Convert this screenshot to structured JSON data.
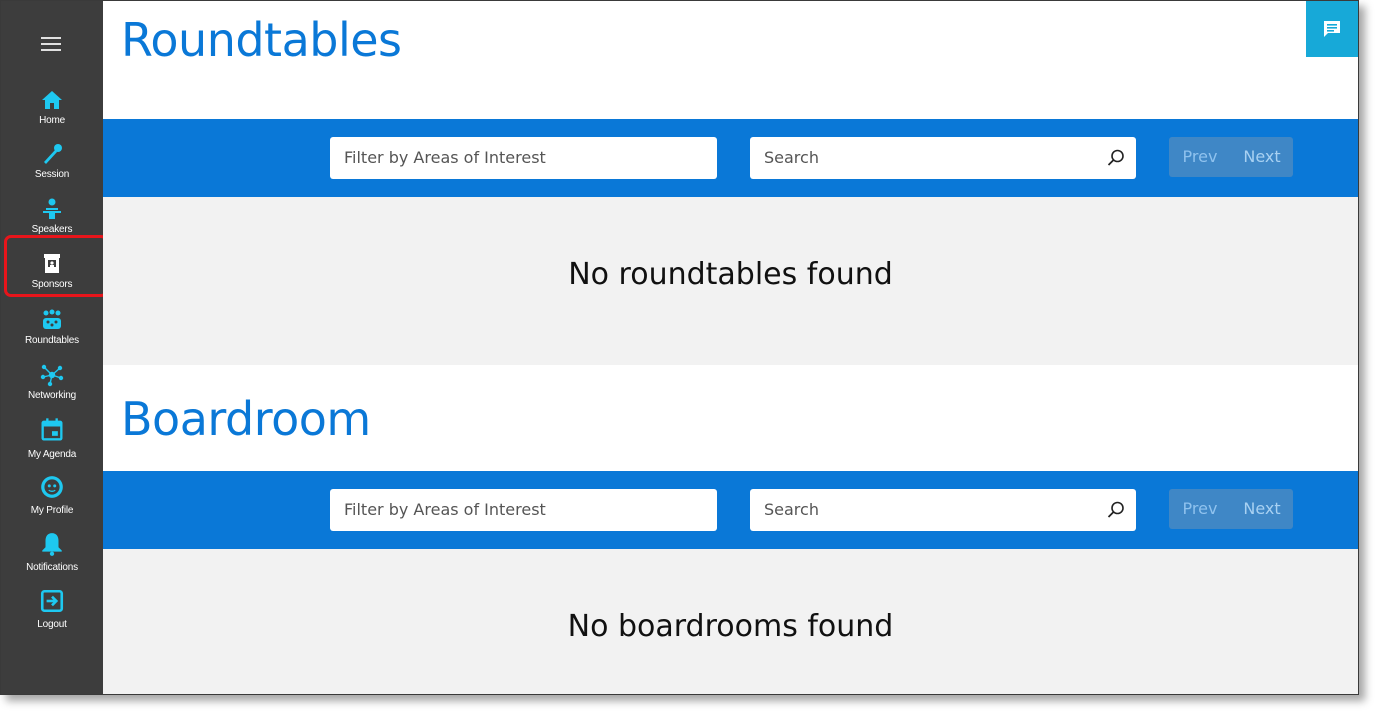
{
  "sidebar": {
    "items": [
      {
        "label": "Home",
        "icon": "home-icon"
      },
      {
        "label": "Session",
        "icon": "microphone-icon"
      },
      {
        "label": "Speakers",
        "icon": "speaker-icon"
      },
      {
        "label": "Sponsors",
        "icon": "booth-icon"
      },
      {
        "label": "Roundtables",
        "icon": "group-icon"
      },
      {
        "label": "Networking",
        "icon": "network-icon"
      },
      {
        "label": "My Agenda",
        "icon": "calendar-icon"
      },
      {
        "label": "My Profile",
        "icon": "profile-icon"
      },
      {
        "label": "Notifications",
        "icon": "bell-icon"
      },
      {
        "label": "Logout",
        "icon": "logout-icon"
      }
    ],
    "highlighted_item": "Sponsors"
  },
  "roundtables": {
    "title": "Roundtables",
    "filter_placeholder": "Filter by Areas of Interest",
    "search_placeholder": "Search",
    "prev_label": "Prev",
    "next_label": "Next",
    "empty_message": "No roundtables found"
  },
  "boardroom": {
    "title": "Boardroom",
    "filter_placeholder": "Filter by Areas of Interest",
    "search_placeholder": "Search",
    "prev_label": "Prev",
    "next_label": "Next",
    "empty_message": "No boardrooms found"
  },
  "chat": {
    "icon": "chat-icon"
  },
  "colors": {
    "accent": "#0a78d7",
    "sidebar": "#3d3d3d",
    "nav_icon": "#1ec8f0",
    "highlight": "#e8151b",
    "chat_button": "#17a9d8"
  }
}
